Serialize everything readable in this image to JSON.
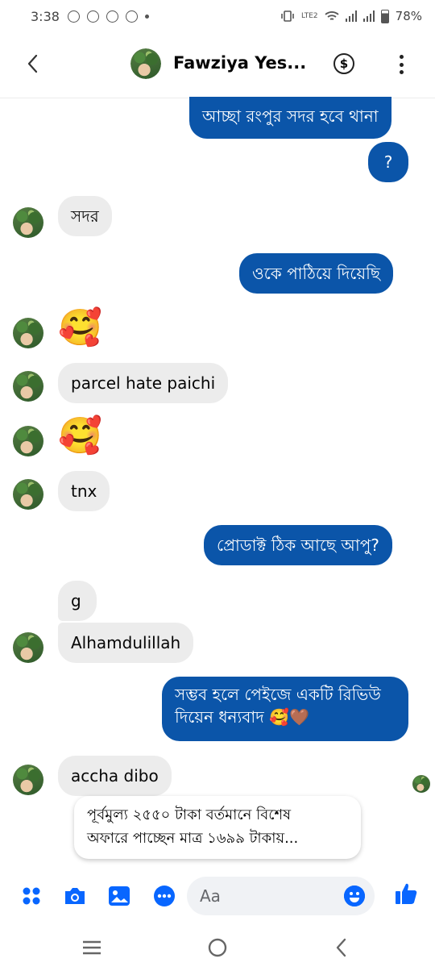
{
  "status_bar": {
    "time": "3:38",
    "battery": "78%",
    "network": "LTE2"
  },
  "header": {
    "title": "Fawziya Yes...",
    "money_symbol": "$"
  },
  "messages": [
    {
      "side": "out",
      "text": "আচ্ছা রংপুর সদর হবে থানা"
    },
    {
      "side": "out",
      "text": "?"
    },
    {
      "side": "in",
      "text": "সদর"
    },
    {
      "side": "out",
      "text": "ওকে পাঠিয়ে দিয়েছি"
    },
    {
      "side": "in",
      "text": "🥰"
    },
    {
      "side": "in",
      "text": "parcel hate paichi"
    },
    {
      "side": "in",
      "text": "🥰"
    },
    {
      "side": "in",
      "text": "tnx"
    },
    {
      "side": "out",
      "text": "প্রোডাক্ট ঠিক আছে আপু?"
    },
    {
      "side": "in",
      "text": "g"
    },
    {
      "side": "in",
      "text": "Alhamdulillah"
    },
    {
      "side": "out",
      "text_line1": "সম্ভব হলে পেইজে একটি রিভিউ",
      "text_line2": "দিয়েন ধন্যবাদ 🥰🤎"
    },
    {
      "side": "in",
      "text": "accha dibo"
    }
  ],
  "suggestion": {
    "line1": "পূর্বমুল্য ২৫৫০ টাকা বর্তমানে বিশেষ",
    "line2": "অফারে পাচ্ছেন মাত্র ১৬৯৯ টাকায়..."
  },
  "composer": {
    "placeholder": "Aa"
  },
  "colors": {
    "outgoing_bubble": "#0b55a9",
    "incoming_bubble": "#ececec",
    "accent": "#0866ff"
  }
}
